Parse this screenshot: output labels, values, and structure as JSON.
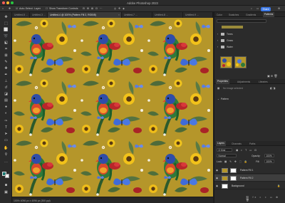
{
  "app": {
    "title": "Adobe Photoshop 2023",
    "share_label": "Share",
    "traffic_colors": [
      "#ff5f57",
      "#febc2e",
      "#28c840"
    ]
  },
  "options_bar": {
    "auto_select_label": "Auto-Select:",
    "auto_select_value": "Layer",
    "show_transform_label": "Show Transform Controls"
  },
  "tabs": [
    {
      "label": "Untitled-5 ..."
    },
    {
      "label": "Untitled-3 ..."
    },
    {
      "label": "Untitled-4 @ 100% (Pattern Fill 2, RGB/8)"
    },
    {
      "label": "Untitled-7 ..."
    },
    {
      "label": "Untitled-8 ..."
    },
    {
      "label": "Untitled-9 ..."
    }
  ],
  "status": {
    "text": "100%   4096 px x 4096 px (300 ppi)"
  },
  "panels": {
    "top_tabs": [
      "Color",
      "Swatches",
      "Gradients",
      "Patterns"
    ],
    "top_active": "Patterns",
    "pattern_groups": [
      "Trees",
      "Grass",
      "Water"
    ],
    "properties_tabs": [
      "Properties",
      "Adjustments",
      "Libraries"
    ],
    "properties_status": "No image selected",
    "pattern_label": "Pattern",
    "layers_tabs": [
      "Layers",
      "Channels",
      "Paths"
    ],
    "kind_label": "Q Kind",
    "blend_mode": "Normal",
    "opacity_label": "Opacity:",
    "opacity_value": "100%",
    "lock_label": "Lock:",
    "fill_label": "Fill:",
    "fill_value": "100%",
    "layers": [
      {
        "name": "Pattern Fill 1",
        "selected": false
      },
      {
        "name": "Pattern Fill 2",
        "selected": true
      },
      {
        "name": "Background",
        "selected": false
      }
    ]
  },
  "colors": {
    "canvas_bg": "#b5962a",
    "accent": "#3b78e7"
  },
  "icons": {
    "tools": [
      "move-tool",
      "artboard-tool",
      "marquee-tool",
      "lasso-tool",
      "object-select-tool",
      "crop-tool",
      "frame-tool",
      "eyedropper-tool",
      "spot-heal-tool",
      "brush-tool",
      "clone-stamp-tool",
      "history-brush-tool",
      "eraser-tool",
      "gradient-tool",
      "blur-tool",
      "dodge-tool",
      "pen-tool",
      "type-tool",
      "path-select-tool",
      "rectangle-tool",
      "hand-tool",
      "zoom-tool"
    ]
  }
}
